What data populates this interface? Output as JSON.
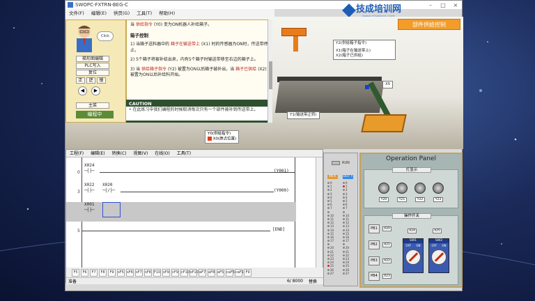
{
  "window": {
    "title": "SWOPC-FXTRN-BEG-C",
    "menu": [
      "文件(F)",
      "编辑(E)",
      "供页(G)",
      "工具(T)",
      "帮助(H)"
    ],
    "logo_text": "技成培训网",
    "logo_sub": "www.jcpeixun.com"
  },
  "guide": {
    "bubble": "Click",
    "buttons": [
      "梯形图编辑",
      "PLC写入",
      "复位"
    ],
    "nav": [
      "正",
      "逆",
      "慢"
    ],
    "arrow_left": "◀",
    "arrow_right": "▶",
    "return_label": "主菜",
    "mode_label": "编程中"
  },
  "instruction": {
    "line0_pre": "当",
    "line0_hl": "供给指令",
    "line0_post": "(Y0) 变为ON机器人补给箱子。",
    "heading": "箱子控制",
    "p1_pre": "1) 当箱子送料器中的",
    "p1_hl": "箱子在输送带上",
    "p1_post": "(X1) 时的传感器为ON时，传送带停止。",
    "p2": "2) 5个箱子将被补给出来，内有5个箱子时输送带移至右边的箱子上。",
    "p3_pre": "3) 当",
    "p3_hl": "供给箱子指令",
    "p3_mid": "(Y2) 被置为ON以后箱子被补出，当",
    "p3_hl2": "箱子已供给",
    "p3_post": "(X2) 被置为ON以后补给料开始。",
    "caution_title": "CAUTION",
    "caution_text": "• 在此练习中我们编程的时候取消每次只有一个部件被补到传送带上。"
  },
  "scene": {
    "title_button": "部件供给控制",
    "label_y2": "Y2(供给箱子指令)",
    "label_x1": "X1(箱子在输送带上)",
    "label_x2": "X2(箱子已供给)",
    "label_x5": "X5",
    "label_y1": "Y1(输送带正转)",
    "label_y0": "Y0(供给指令)",
    "label_x0": "X0(原点位置)"
  },
  "editor": {
    "menu": [
      "工程(F)",
      "编辑(E)",
      "转换(C)",
      "视图(V)",
      "在线(O)",
      "工具(T)"
    ],
    "rungs": [
      {
        "num": "0",
        "contacts": [
          "X024"
        ],
        "coil": "Y001"
      },
      {
        "num": "3",
        "contacts": [
          "X022",
          "X020"
        ],
        "coil": "Y000"
      },
      {
        "num": "",
        "contacts": [
          "X001"
        ],
        "coil": ""
      },
      {
        "num": "5",
        "contacts": [],
        "coil": "END"
      }
    ],
    "toolbar": [
      "F5",
      "F6",
      "F7",
      "F8",
      "F9",
      "sF5",
      "sF6",
      "sF7",
      "sF8",
      "F10",
      "sF9",
      "cF9",
      "cF10",
      "sF10",
      "aF7",
      "aF8",
      "aF5",
      "caF5",
      "caF10",
      "F9"
    ],
    "status_left": "准备",
    "status_steps": "6/ 8000",
    "status_right": "替换"
  },
  "io": {
    "run_label": "RUN",
    "in_header": "IN X",
    "out_header": "OUT Y",
    "in_rows": [
      "0",
      "1",
      "2",
      "3",
      "4",
      "5",
      "6",
      "7",
      "",
      "10",
      "11",
      "12",
      "13",
      "14",
      "15",
      "16",
      "17",
      "",
      "20",
      "21",
      "22",
      "23",
      "24",
      "25",
      "26",
      "27"
    ],
    "out_rows": [
      "0",
      "1",
      "2",
      "3",
      "4",
      "5",
      "6",
      "7",
      "",
      "10",
      "11",
      "12",
      "13",
      "14",
      "15",
      "16",
      "17",
      "",
      "20",
      "21",
      "22",
      "23",
      "24",
      "25",
      "26",
      "27"
    ],
    "in_on": [
      23
    ],
    "out_on": [
      1
    ]
  },
  "panel": {
    "title": "Operation Panel",
    "lamp_section": "灯显示",
    "lamps": [
      "Y20",
      "Y21",
      "Y22",
      "Y23"
    ],
    "switch_section": "操作开关",
    "pbs": [
      {
        "name": "PB1",
        "tag": "X20"
      },
      {
        "name": "PB2",
        "tag": "X21"
      },
      {
        "name": "PB3",
        "tag": "X22"
      },
      {
        "name": "PB4",
        "tag": "X23"
      }
    ],
    "sw_tags": [
      "X24",
      "X25"
    ],
    "sw_labels": [
      "SW1",
      "SW2"
    ],
    "off_label": "OFF",
    "on_label": "ON"
  }
}
